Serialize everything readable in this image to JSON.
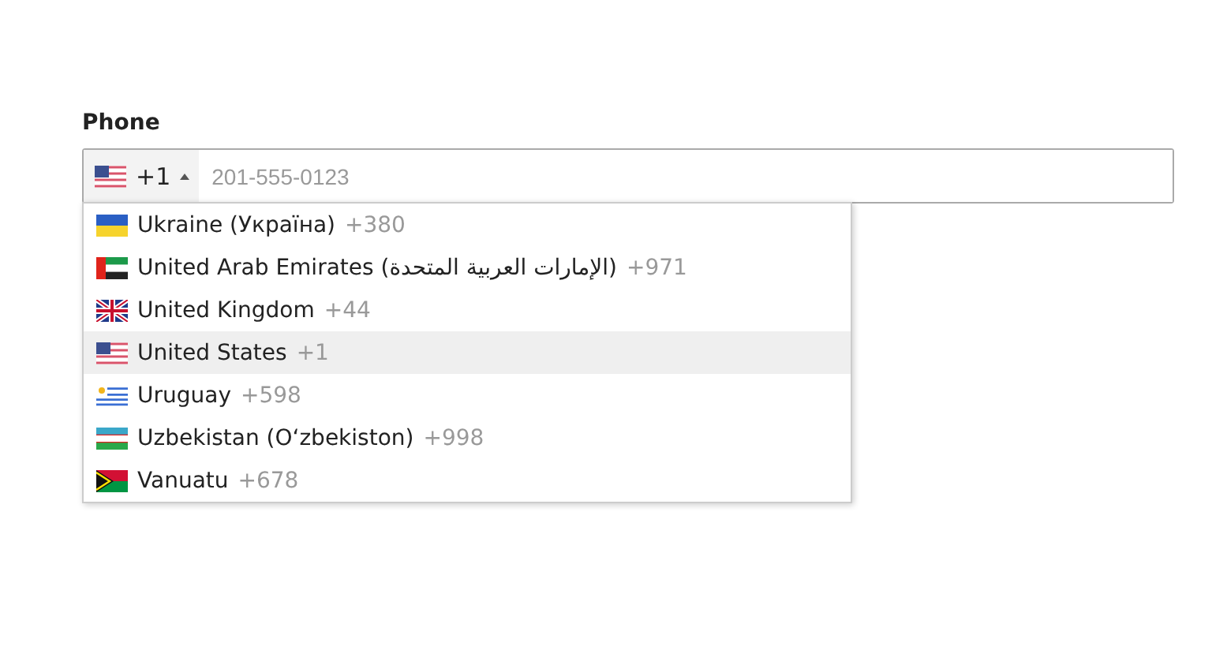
{
  "label": "Phone",
  "phone_field": {
    "dial_code": "+1",
    "expanded": true,
    "placeholder": "201-555-0123"
  },
  "countries": [
    {
      "name": "Ukraine (Україна)",
      "dial_code": "+380",
      "selected": false
    },
    {
      "name": "United Arab Emirates (الإمارات العربية المتحدة)",
      "dial_code": "+971",
      "selected": false
    },
    {
      "name": "United Kingdom",
      "dial_code": "+44",
      "selected": false
    },
    {
      "name": "United States",
      "dial_code": "+1",
      "selected": true
    },
    {
      "name": "Uruguay",
      "dial_code": "+598",
      "selected": false
    },
    {
      "name": "Uzbekistan (Oʻzbekiston)",
      "dial_code": "+998",
      "selected": false
    },
    {
      "name": "Vanuatu",
      "dial_code": "+678",
      "selected": false
    }
  ]
}
